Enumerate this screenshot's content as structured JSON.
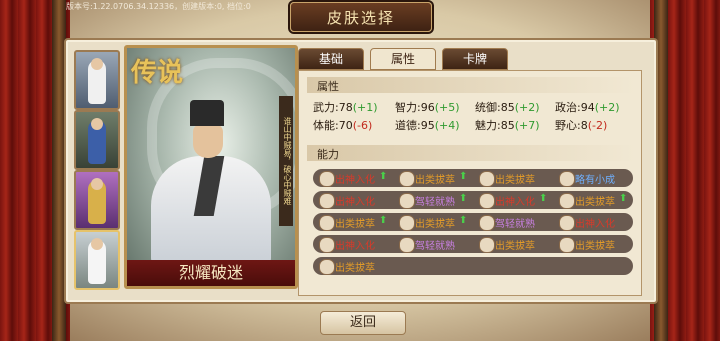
{
  "header": {
    "version": "版本号:1.22.0706.34.12336，创建版本:0, 档位:0",
    "title": "皮肤选择"
  },
  "portrait": {
    "legend_mark": "传说",
    "side_text": "谁山中贼易，破心中贼难",
    "name": "烈耀破迷"
  },
  "tabs": [
    {
      "label": "基础"
    },
    {
      "label": "属性"
    },
    {
      "label": "卡牌"
    }
  ],
  "attributes": {
    "heading": "属性",
    "items": [
      {
        "name": "武力",
        "value": "78",
        "delta": "(+1)"
      },
      {
        "name": "智力",
        "value": "96",
        "delta": "(+5)"
      },
      {
        "name": "统御",
        "value": "85",
        "delta": "(+2)"
      },
      {
        "name": "政治",
        "value": "94",
        "delta": "(+2)"
      },
      {
        "name": "体能",
        "value": "70",
        "delta": "(-6)"
      },
      {
        "name": "道德",
        "value": "95",
        "delta": "(+4)"
      },
      {
        "name": "魅力",
        "value": "85",
        "delta": "(+7)"
      },
      {
        "name": "野心",
        "value": "8",
        "delta": "(-2)"
      }
    ]
  },
  "abilities": {
    "heading": "能力",
    "rows": [
      [
        {
          "label": "出神入化",
          "up": "⬆"
        },
        {
          "label": "出类拔萃",
          "up": "⬆"
        },
        {
          "label": "出类拔萃",
          "up": ""
        },
        {
          "label": "略有小成",
          "up": ""
        }
      ],
      [
        {
          "label": "出神入化",
          "up": ""
        },
        {
          "label": "驾轻就熟",
          "up": "⬆"
        },
        {
          "label": "出神入化",
          "up": "⬆"
        },
        {
          "label": "出类拔萃",
          "up": "⬆"
        }
      ],
      [
        {
          "label": "出类拔萃",
          "up": "⬆"
        },
        {
          "label": "出类拔萃",
          "up": "⬆"
        },
        {
          "label": "驾轻就熟",
          "up": ""
        },
        {
          "label": "出神入化",
          "up": ""
        }
      ],
      [
        {
          "label": "出神入化",
          "up": ""
        },
        {
          "label": "驾轻就熟",
          "up": ""
        },
        {
          "label": "出类拔萃",
          "up": ""
        },
        {
          "label": "出类拔萃",
          "up": ""
        }
      ],
      [
        {
          "label": "出类拔萃",
          "up": ""
        }
      ]
    ]
  },
  "back_label": "返回"
}
